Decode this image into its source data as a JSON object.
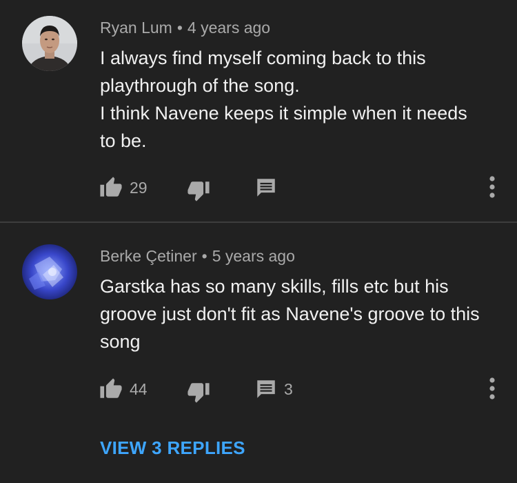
{
  "comments": [
    {
      "author": "Ryan Lum",
      "separator": "•",
      "time": "4 years ago",
      "lines": [
        "I always find myself coming back to this",
        "playthrough of the song.",
        "I think Navene keeps it simple when it needs",
        "to be."
      ],
      "like_count": "29",
      "reply_count": "",
      "avatar_icon": "user-photo-avatar"
    },
    {
      "author": "Berke Çetiner",
      "separator": "•",
      "time": "5 years ago",
      "lines": [
        "Garstka has so many skills, fills etc but his",
        "groove just don't fit as Navene's groove to this",
        "song"
      ],
      "like_count": "44",
      "reply_count": "3",
      "view_replies_label": "VIEW 3 REPLIES",
      "avatar_icon": "abstract-blue-avatar"
    }
  ],
  "icons": {
    "like": "thumbs-up-icon",
    "dislike": "thumbs-down-icon",
    "reply": "reply-comment-icon",
    "more": "more-vertical-icon"
  },
  "colors": {
    "background": "#212121",
    "text_primary": "#f1f1f1",
    "text_secondary": "#aaaaaa",
    "link": "#3ea6ff",
    "divider": "#3d3d3d"
  }
}
